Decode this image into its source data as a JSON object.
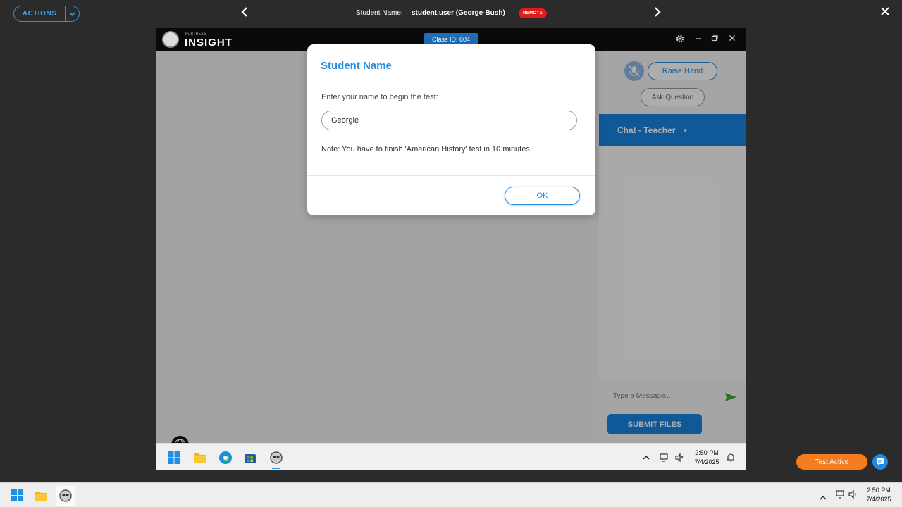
{
  "topbar": {
    "actions_label": "ACTIONS",
    "student_label": "Student Name:",
    "student_value": "student.user (George-Bush)",
    "remote_badge": "REMOTE"
  },
  "remote": {
    "logo_small": "FORTRESS",
    "logo_text": "INSIGHT",
    "class_id": "Class ID: 604",
    "sidepanel": {
      "raise_hand": "Raise Hand",
      "ask_question": "Ask Question",
      "chat_title": "Chat - Teacher",
      "message_placeholder": "Type a Message...",
      "submit_files": "SUBMIT FILES"
    },
    "taskbar": {
      "time": "2:50 PM",
      "date": "7/4/2025"
    }
  },
  "dialog": {
    "title": "Student Name",
    "prompt": "Enter your name to begin the test:",
    "input_value": "Georgie",
    "note": "Note: You have to finish 'American History' test in 10 minutes",
    "ok_label": "OK"
  },
  "status": {
    "test_active": "Test Active"
  },
  "host_taskbar": {
    "time": "2:50 PM",
    "date": "7/4/2025"
  },
  "colors": {
    "accent": "#2a8de0",
    "chat_header": "#1884e2",
    "remote_badge": "#e21b1b",
    "test_active": "#f57c1f"
  }
}
